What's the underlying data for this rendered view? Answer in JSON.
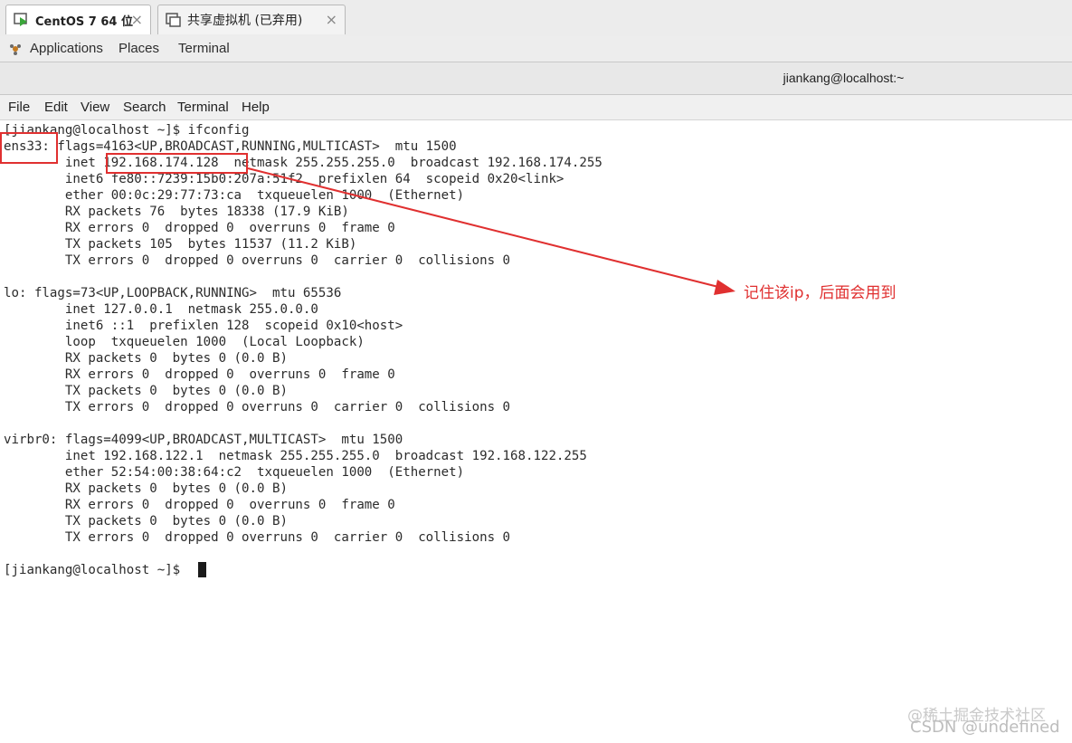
{
  "vm_tabs": [
    {
      "label": "CentOS 7 64 位",
      "close": "×",
      "active": true
    },
    {
      "label": "共享虚拟机 (已弃用)",
      "close": "×",
      "active": false
    }
  ],
  "gnome_bar": {
    "applications": "Applications",
    "places": "Places",
    "terminal": "Terminal"
  },
  "window_title": "jiankang@localhost:~",
  "menu": [
    "File",
    "Edit",
    "View",
    "Search",
    "Terminal",
    "Help"
  ],
  "terminal_lines": [
    "[jiankang@localhost ~]$ ifconfig",
    "ens33: flags=4163<UP,BROADCAST,RUNNING,MULTICAST>  mtu 1500",
    "        inet 192.168.174.128  netmask 255.255.255.0  broadcast 192.168.174.255",
    "        inet6 fe80::7239:15b0:207a:51f2  prefixlen 64  scopeid 0x20<link>",
    "        ether 00:0c:29:77:73:ca  txqueuelen 1000  (Ethernet)",
    "        RX packets 76  bytes 18338 (17.9 KiB)",
    "        RX errors 0  dropped 0  overruns 0  frame 0",
    "        TX packets 105  bytes 11537 (11.2 KiB)",
    "        TX errors 0  dropped 0 overruns 0  carrier 0  collisions 0",
    "",
    "lo: flags=73<UP,LOOPBACK,RUNNING>  mtu 65536",
    "        inet 127.0.0.1  netmask 255.0.0.0",
    "        inet6 ::1  prefixlen 128  scopeid 0x10<host>",
    "        loop  txqueuelen 1000  (Local Loopback)",
    "        RX packets 0  bytes 0 (0.0 B)",
    "        RX errors 0  dropped 0  overruns 0  frame 0",
    "        TX packets 0  bytes 0 (0.0 B)",
    "        TX errors 0  dropped 0 overruns 0  carrier 0  collisions 0",
    "",
    "virbr0: flags=4099<UP,BROADCAST,MULTICAST>  mtu 1500",
    "        inet 192.168.122.1  netmask 255.255.255.0  broadcast 192.168.122.255",
    "        ether 52:54:00:38:64:c2  txqueuelen 1000  (Ethernet)",
    "        RX packets 0  bytes 0 (0.0 B)",
    "        RX errors 0  dropped 0  overruns 0  frame 0",
    "        TX packets 0  bytes 0 (0.0 B)",
    "        TX errors 0  dropped 0 overruns 0  carrier 0  collisions 0",
    "",
    "[jiankang@localhost ~]$ "
  ],
  "annotation": "记住该ip，后面会用到",
  "watermark": {
    "line1": "@稀土掘金技术社区",
    "line2": "CSDN @undefined"
  },
  "colors": {
    "annotation": "#e03030",
    "terminal_text": "#2b2b2b"
  }
}
